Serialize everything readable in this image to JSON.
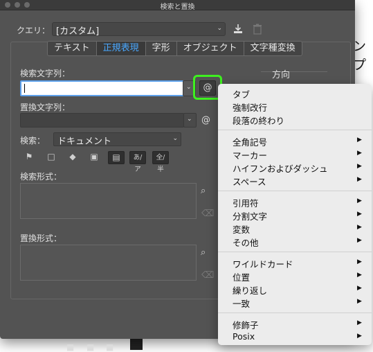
{
  "window": {
    "title": "検索と置換"
  },
  "background": {
    "doc_text": "ンプ"
  },
  "query": {
    "label": "クエリ：",
    "value": "[カスタム]"
  },
  "tabs": [
    {
      "label": "テキスト",
      "active": false
    },
    {
      "label": "正規表現",
      "active": true
    },
    {
      "label": "字形",
      "active": false
    },
    {
      "label": "オブジェクト",
      "active": false
    },
    {
      "label": "文字種変換",
      "active": false
    }
  ],
  "find": {
    "label": "検索文字列：",
    "value": ""
  },
  "replace": {
    "label": "置換文字列：",
    "value": ""
  },
  "search": {
    "label": "検索：",
    "value": "ドキュメント"
  },
  "options": {
    "kana": "あ/ア",
    "width": "全/半"
  },
  "find_format": {
    "label": "検索形式："
  },
  "replace_format": {
    "label": "置換形式："
  },
  "direction": {
    "label": "方向"
  },
  "special_button": {
    "symbol": "@"
  },
  "menu": {
    "groups": [
      [
        {
          "label": "タブ",
          "submenu": false
        },
        {
          "label": "強制改行",
          "submenu": false
        },
        {
          "label": "段落の終わり",
          "submenu": false
        }
      ],
      [
        {
          "label": "全角記号",
          "submenu": true
        },
        {
          "label": "マーカー",
          "submenu": true
        },
        {
          "label": "ハイフンおよびダッシュ",
          "submenu": true
        },
        {
          "label": "スペース",
          "submenu": true
        }
      ],
      [
        {
          "label": "引用符",
          "submenu": true
        },
        {
          "label": "分割文字",
          "submenu": true
        },
        {
          "label": "変数",
          "submenu": true
        },
        {
          "label": "その他",
          "submenu": true
        }
      ],
      [
        {
          "label": "ワイルドカード",
          "submenu": true
        },
        {
          "label": "位置",
          "submenu": true
        },
        {
          "label": "繰り返し",
          "submenu": true
        },
        {
          "label": "一致",
          "submenu": true
        }
      ],
      [
        {
          "label": "修飾子",
          "submenu": true
        },
        {
          "label": "Posix",
          "submenu": true
        }
      ]
    ]
  },
  "colors": {
    "accent_tab": "#4aa8ff",
    "highlight": "#3ef020",
    "focus": "#5da0ea"
  }
}
